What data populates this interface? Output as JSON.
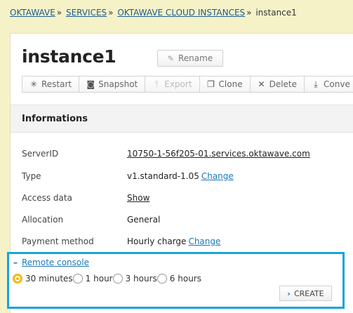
{
  "breadcrumb": {
    "items": [
      "OKTAWAVE",
      "SERVICES",
      "OKTAWAVE CLOUD INSTANCES"
    ],
    "separator": "»",
    "current": "instance1"
  },
  "header": {
    "title": "instance1",
    "rename_label": "Rename"
  },
  "toolbar": {
    "buttons": [
      {
        "label": "Restart",
        "icon": "restart-icon"
      },
      {
        "label": "Snapshot",
        "icon": "camera-icon"
      },
      {
        "label": "Export",
        "icon": "export-icon",
        "disabled": true
      },
      {
        "label": "Clone",
        "icon": "clone-icon"
      },
      {
        "label": "Delete",
        "icon": "delete-icon"
      },
      {
        "label": "Conve",
        "icon": "download-icon"
      }
    ]
  },
  "info": {
    "heading": "Informations",
    "server_id_label": "ServerID",
    "server_id_value": "10750-1-56f205-01.services.oktawave.com",
    "type_label": "Type",
    "type_value": "v1.standard-1.05",
    "type_change": "Change",
    "access_label": "Access data",
    "access_value": "Show",
    "allocation_label": "Allocation",
    "allocation_value": "General",
    "payment_label": "Payment method",
    "payment_value": "Hourly charge",
    "payment_change": "Change"
  },
  "console": {
    "toggle_symbol": "–",
    "title": "Remote console",
    "options": [
      "30 minutes",
      "1 hour",
      "3 hours",
      "6 hours"
    ],
    "selected": "30 minutes",
    "create_label": "CREATE"
  },
  "colors": {
    "background": "#f6f2c8",
    "highlight_border": "#1aa3dc",
    "link": "#1a78b8",
    "radio_selected": "#f2b90f"
  }
}
